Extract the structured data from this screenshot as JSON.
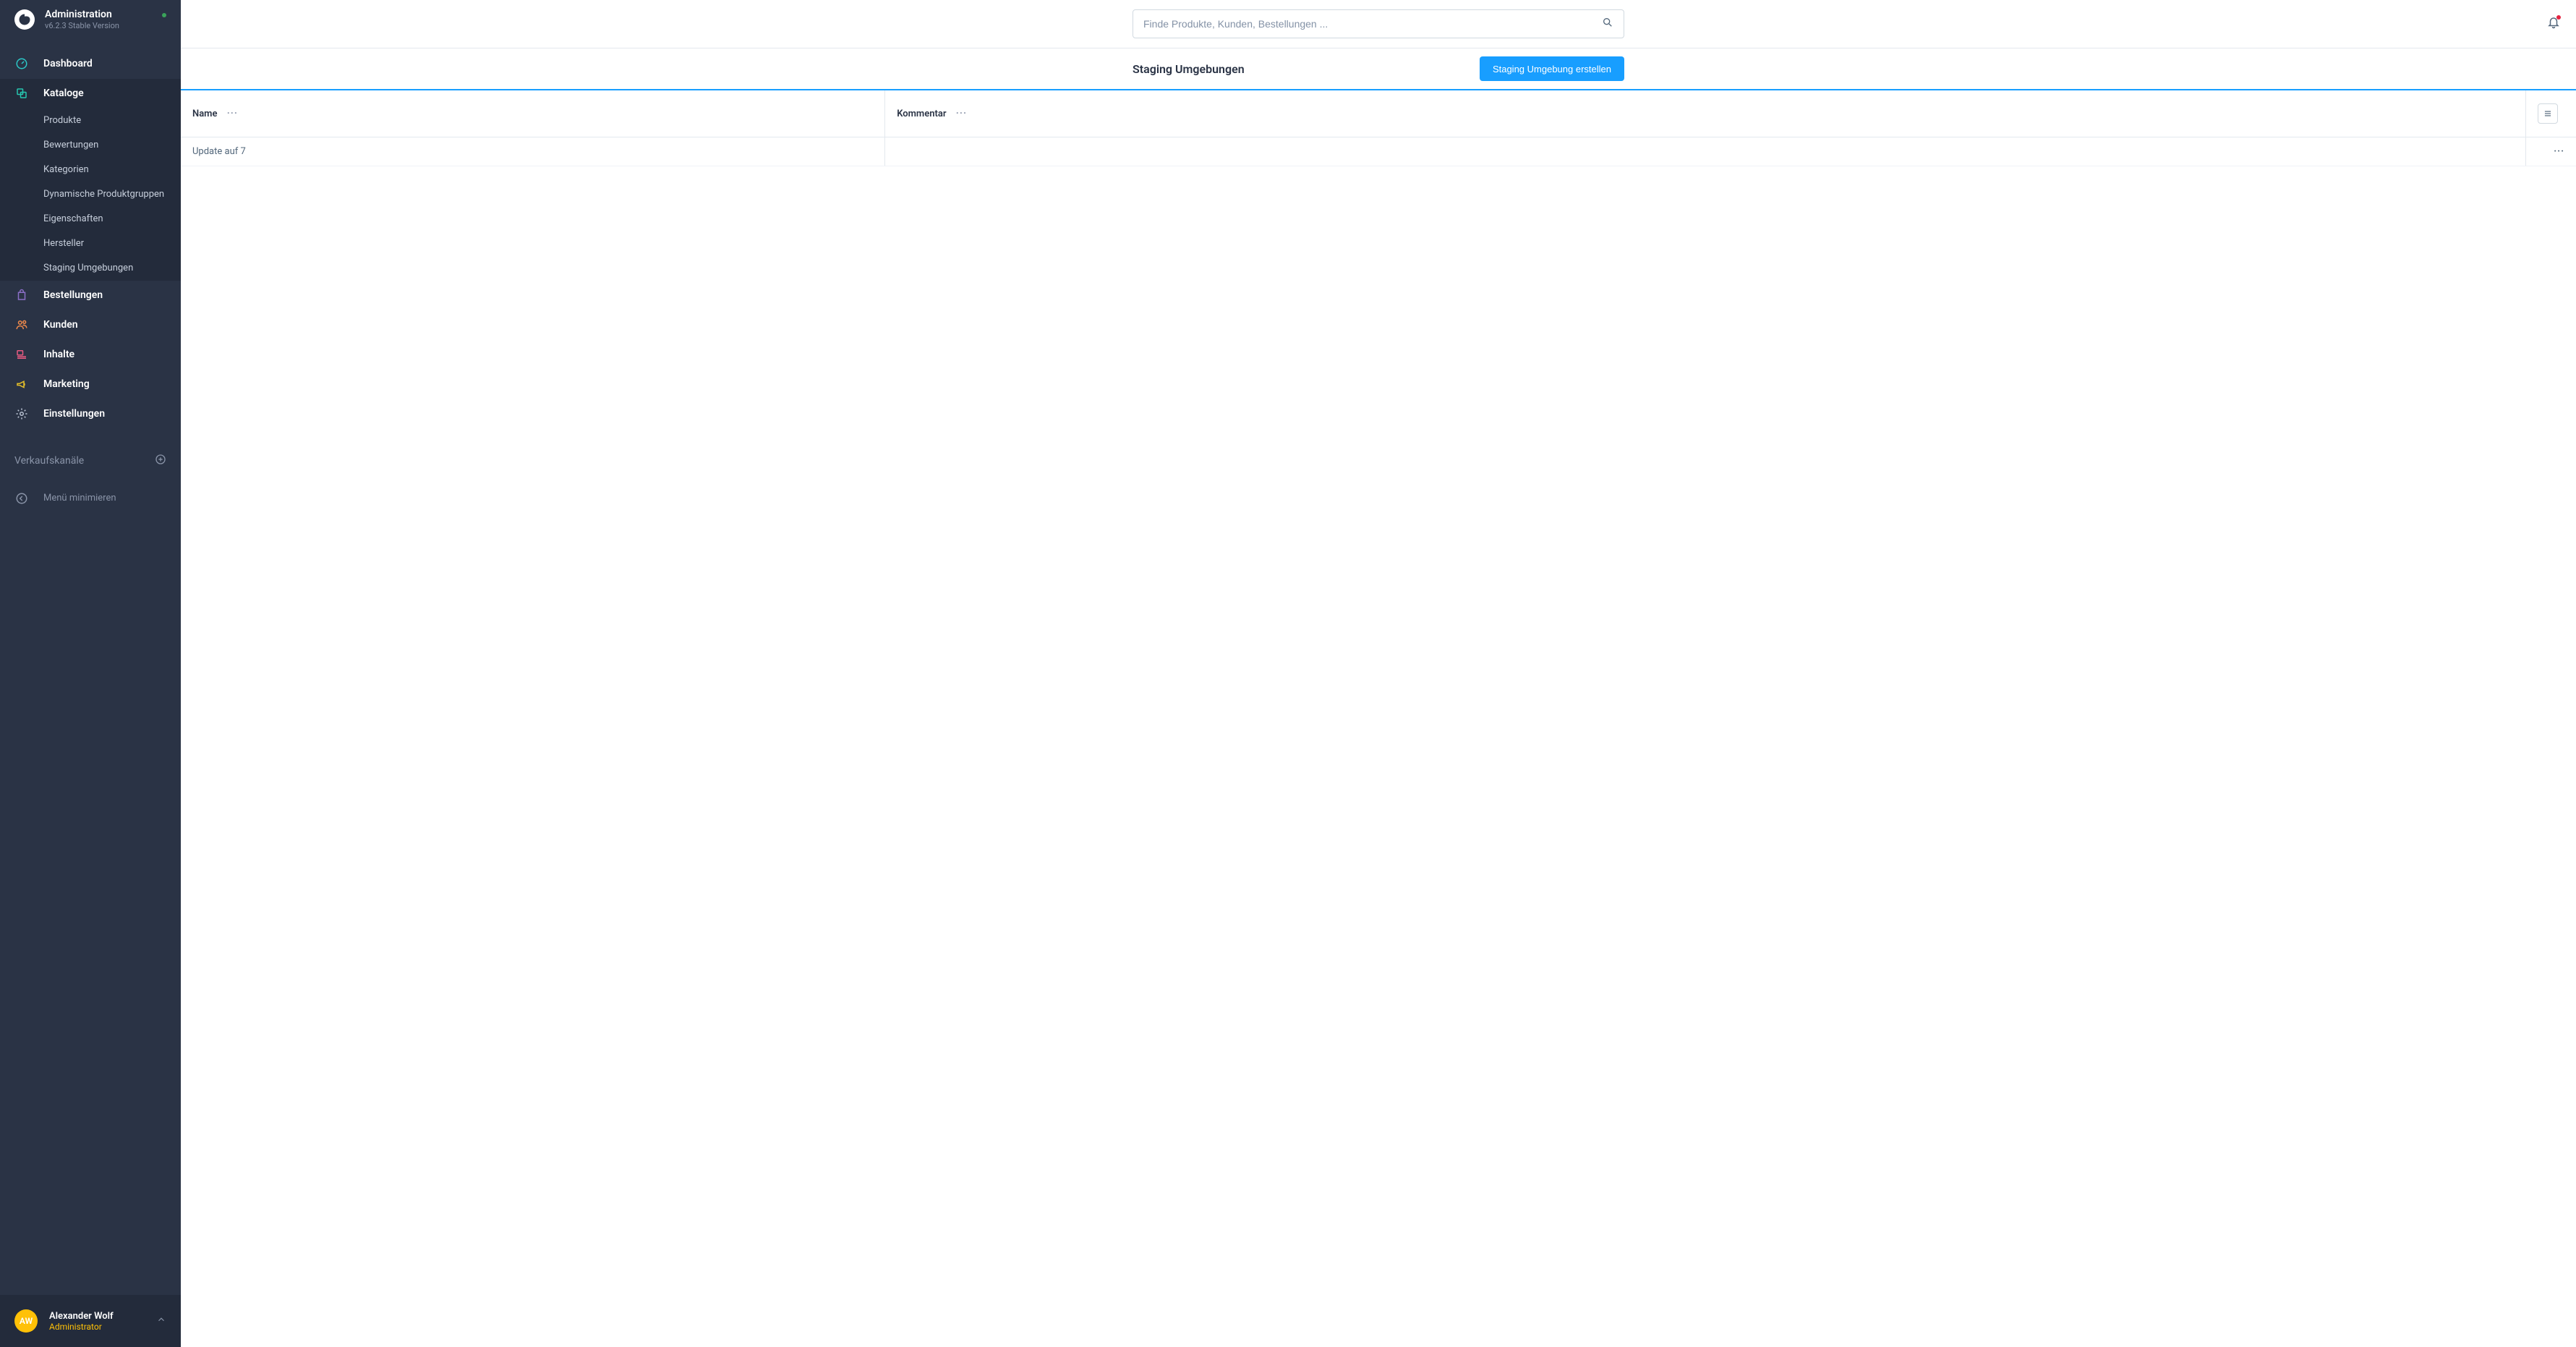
{
  "app": {
    "title": "Administration",
    "version": "v6.2.3 Stable Version"
  },
  "search": {
    "placeholder": "Finde Produkte, Kunden, Bestellungen ..."
  },
  "page": {
    "title": "Staging Umgebungen",
    "create_button": "Staging Umgebung erstellen"
  },
  "sidebar": {
    "items": [
      {
        "label": "Dashboard"
      },
      {
        "label": "Kataloge"
      },
      {
        "label": "Bestellungen"
      },
      {
        "label": "Kunden"
      },
      {
        "label": "Inhalte"
      },
      {
        "label": "Marketing"
      },
      {
        "label": "Einstellungen"
      }
    ],
    "catalog_sub": [
      {
        "label": "Produkte"
      },
      {
        "label": "Bewertungen"
      },
      {
        "label": "Kategorien"
      },
      {
        "label": "Dynamische Produktgruppen"
      },
      {
        "label": "Eigenschaften"
      },
      {
        "label": "Hersteller"
      },
      {
        "label": "Staging Umgebungen"
      }
    ],
    "sales_channels_label": "Verkaufskanäle",
    "minimize_label": "Menü minimieren"
  },
  "user": {
    "initials": "AW",
    "name": "Alexander Wolf",
    "role": "Administrator"
  },
  "table": {
    "columns": {
      "name": "Name",
      "comment": "Kommentar"
    },
    "rows": [
      {
        "name": "Update auf 7",
        "comment": ""
      }
    ]
  }
}
